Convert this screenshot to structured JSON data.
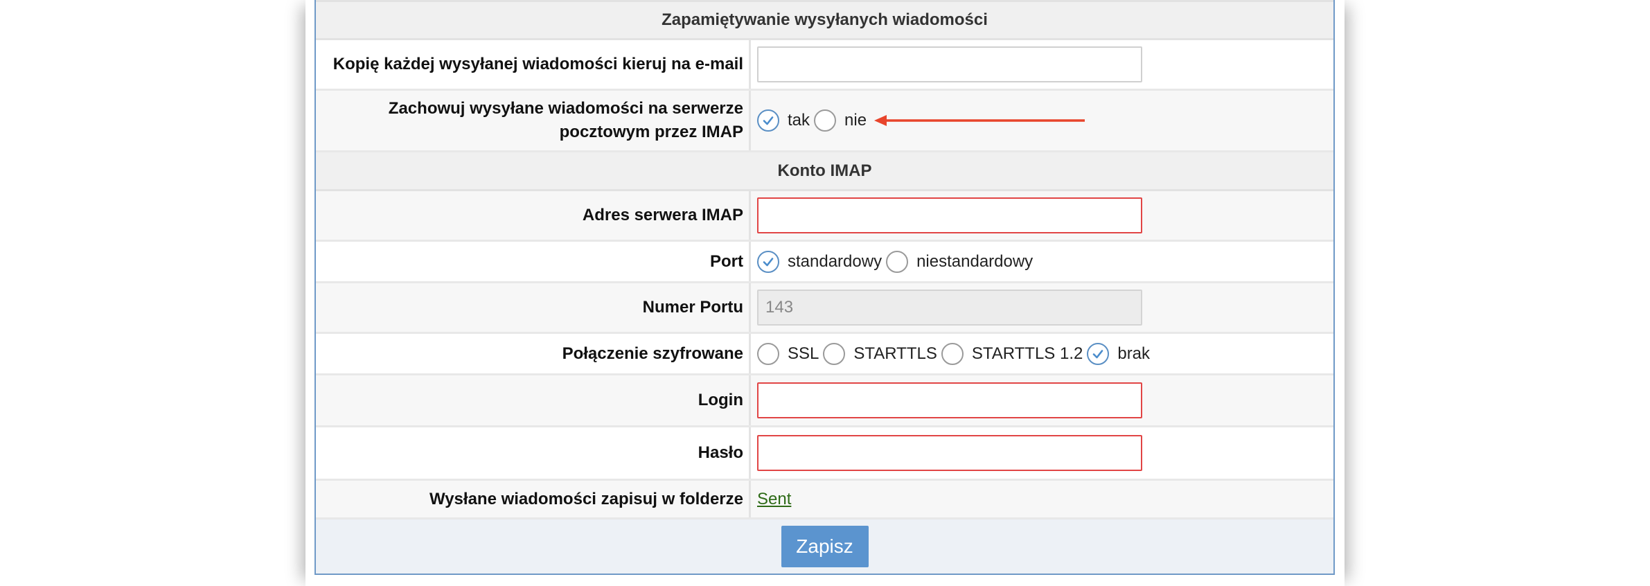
{
  "section_sent": {
    "title": "Zapamiętywanie wysyłanych wiadomości"
  },
  "copy_email": {
    "label": "Kopię każdej wysyłanej wiadomości kieruj na e-mail",
    "value": ""
  },
  "keep_sent": {
    "label_line1": "Zachowuj wysyłane wiadomości na serwerze",
    "label_line2": "pocztowym przez IMAP",
    "options": [
      "tak",
      "nie"
    ],
    "selected": "tak"
  },
  "section_imap": {
    "title": "Konto IMAP"
  },
  "imap_server": {
    "label": "Adres serwera IMAP",
    "value": ""
  },
  "port": {
    "label": "Port",
    "options": [
      "standardowy",
      "niestandardowy"
    ],
    "selected": "standardowy"
  },
  "port_number": {
    "label": "Numer Portu",
    "value": "143"
  },
  "encryption": {
    "label": "Połączenie szyfrowane",
    "options": [
      "SSL",
      "STARTTLS",
      "STARTTLS 1.2",
      "brak"
    ],
    "selected": "brak"
  },
  "login": {
    "label": "Login",
    "value": ""
  },
  "password": {
    "label": "Hasło",
    "value": ""
  },
  "sent_folder": {
    "label": "Wysłane wiadomości zapisuj w folderze",
    "value": "Sent"
  },
  "actions": {
    "save_label": "Zapisz"
  },
  "colors": {
    "accent": "#5b94cf",
    "error_border": "#e14545",
    "arrow": "#e8452c",
    "link": "#2e6b17"
  }
}
